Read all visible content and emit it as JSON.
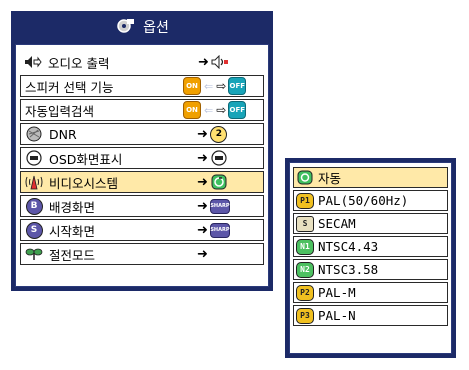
{
  "menu": {
    "title": "옵션",
    "items": [
      {
        "label": "오디오 출력",
        "left_icon": "speaker-arrow-icon",
        "right_icon": "speaker-icon",
        "has_arrow": true
      },
      {
        "label": "스피커 선택 기능",
        "toggle_on": "ON",
        "toggle_off": "OFF"
      },
      {
        "label": "자동입력검색",
        "toggle_on": "ON",
        "toggle_off": "OFF"
      },
      {
        "label": "DNR",
        "left_icon": "dnr-icon",
        "right_value": "2",
        "has_arrow": true
      },
      {
        "label": "OSD화면표시",
        "left_icon": "osd-icon",
        "right_icon": "osd-icon",
        "has_arrow": true
      },
      {
        "label": "비디오시스템",
        "left_icon": "antenna-icon",
        "right_icon": "auto-icon",
        "has_arrow": true,
        "highlighted": true
      },
      {
        "label": "배경화면",
        "left_icon": "b-icon",
        "right_label": "SHARP",
        "has_arrow": true
      },
      {
        "label": "시작화면",
        "left_icon": "s-icon",
        "right_label": "SHARP",
        "has_arrow": true
      },
      {
        "label": "절전모드",
        "left_icon": "power-save-icon",
        "has_arrow": true
      }
    ]
  },
  "submenu": {
    "items": [
      {
        "badge": "auto",
        "label": "자동",
        "highlighted": true
      },
      {
        "badge": "P1",
        "label": "PAL(50/60Hz)"
      },
      {
        "badge": "S",
        "label": "SECAM"
      },
      {
        "badge": "N1",
        "label": "NTSC4.43"
      },
      {
        "badge": "N2",
        "label": "NTSC3.58"
      },
      {
        "badge": "P2",
        "label": "PAL-M"
      },
      {
        "badge": "P3",
        "label": "PAL-N"
      }
    ]
  },
  "colors": {
    "frame": "#1c2a67",
    "highlight": "#ffe9a8",
    "toggle_on": "#f0a000",
    "toggle_off": "#18a4b8"
  }
}
